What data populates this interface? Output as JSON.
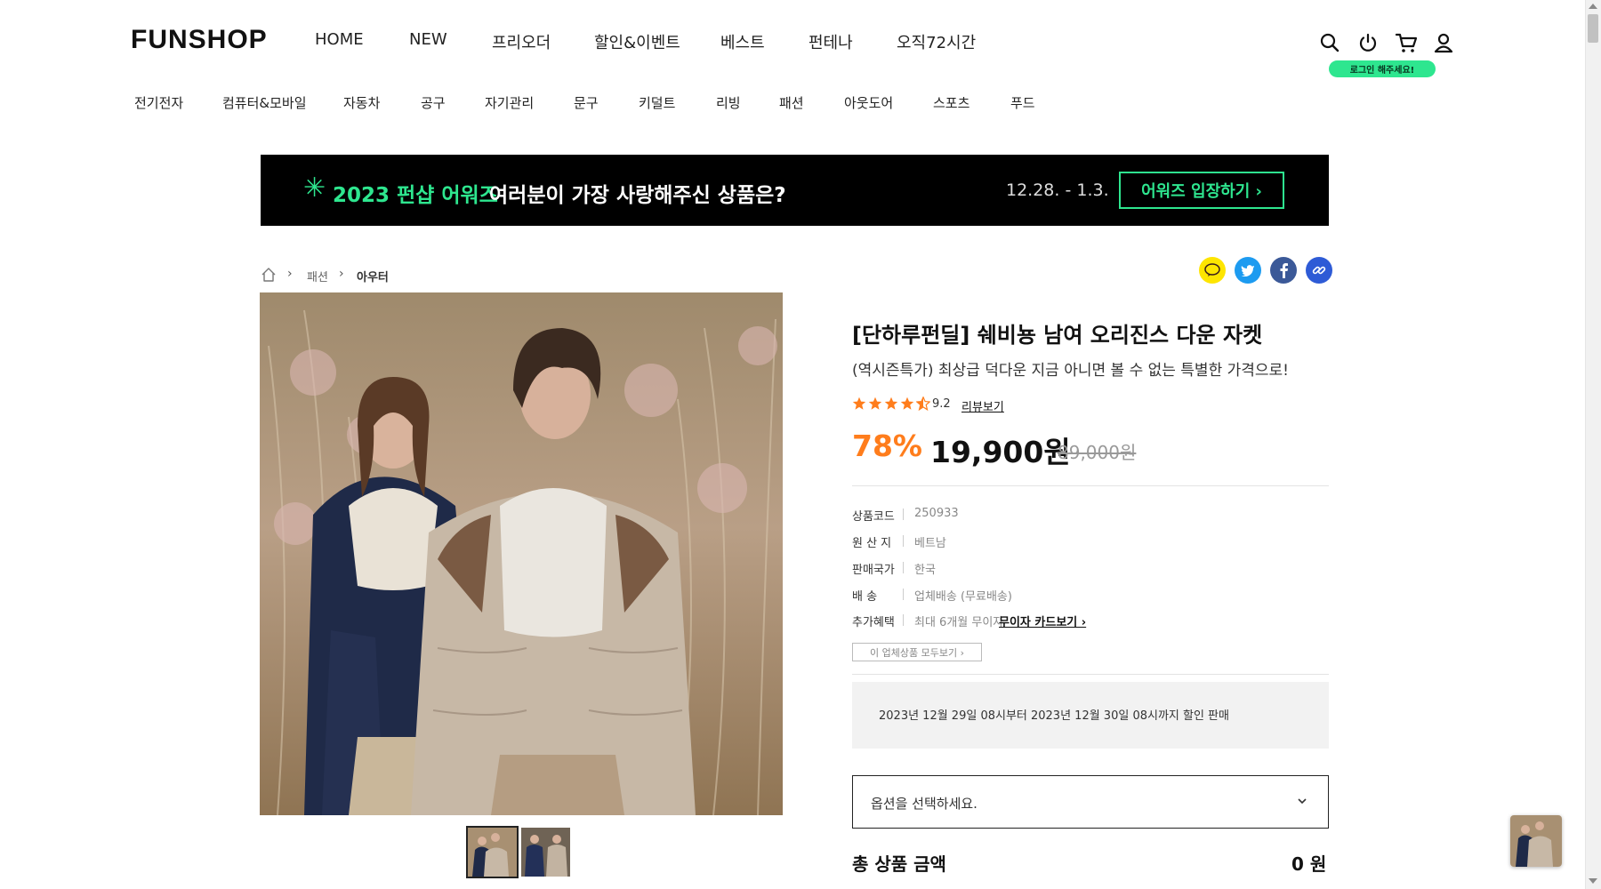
{
  "header": {
    "logo": "FUNSHOP",
    "gnb": [
      "HOME",
      "NEW",
      "프리오더",
      "할인&이벤트",
      "베스트",
      "펀테나",
      "오직72시간"
    ],
    "login_tooltip": "로그인 해주세요!",
    "icons": [
      "search-icon",
      "power-icon",
      "cart-icon",
      "user-icon"
    ]
  },
  "categories": [
    "전기전자",
    "컴퓨터&모바일",
    "자동차",
    "공구",
    "자기관리",
    "문구",
    "키덜트",
    "리빙",
    "패션",
    "아웃도어",
    "스포츠",
    "푸드"
  ],
  "banner": {
    "star": "✳",
    "title": "2023 펀샵 어워즈",
    "subtitle": "여러분이 가장 사랑해주신 상품은?",
    "date": "12.28. - 1.3.",
    "button": "어워즈 입장하기 ›",
    "accent": "#2ee68f"
  },
  "breadcrumb": [
    "패션",
    "아우터"
  ],
  "share": [
    "kakao-icon",
    "twitter-icon",
    "facebook-icon",
    "link-icon"
  ],
  "product": {
    "title": "[단하루펀딜] 쉐비뇽 남여 오리진스 다운 자켓",
    "subtitle": "(역시즌특가) 최상급 덕다운 지금 아니면 볼 수 없는 특별한 가격으로!",
    "rating": "9.2",
    "stars": 4.5,
    "review_link": "리뷰보기",
    "discount": "78%",
    "price": "19,900원",
    "original_price": "89,000원",
    "discount_color": "#ff7d1c",
    "specs": [
      {
        "label": "상품코드",
        "value": "250933"
      },
      {
        "label": "원 산 지",
        "value": "베트남"
      },
      {
        "label": "판매국가",
        "value": "한국"
      },
      {
        "label": "배 송",
        "value": "업체배송 (무료배송)"
      },
      {
        "label": "추가혜택",
        "value": "최대 6개월 무이자"
      }
    ],
    "card_link": "무이자 카드보기 ›",
    "brand_button": "이 업체상품 모두보기 ›",
    "notice": "2023년 12월 29일 08시부터 2023년 12월 30일 08시까지 할인 판매",
    "option_placeholder": "옵션을 선택하세요.",
    "total_label": "총 상품 금액",
    "total_value": "0 원"
  }
}
